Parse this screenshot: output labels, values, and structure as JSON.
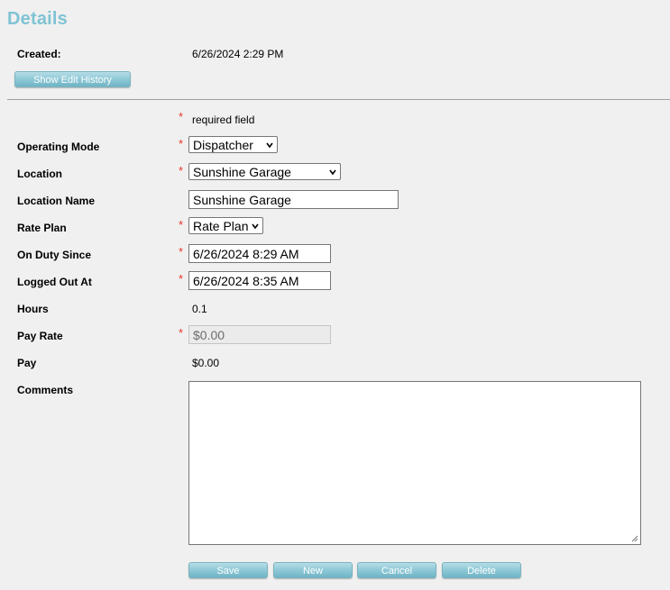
{
  "header": {
    "title": "Details"
  },
  "created": {
    "label": "Created:",
    "value": "6/26/2024 2:29 PM"
  },
  "show_history_button": "Show Edit History",
  "required_note": {
    "marker": "*",
    "text": "required field"
  },
  "fields": {
    "operating_mode": {
      "label": "Operating Mode",
      "value": "Dispatcher"
    },
    "location": {
      "label": "Location",
      "value": "Sunshine Garage"
    },
    "location_name": {
      "label": "Location Name",
      "value": "Sunshine Garage"
    },
    "rate_plan": {
      "label": "Rate Plan",
      "value": "Rate Plan"
    },
    "on_duty_since": {
      "label": "On Duty Since",
      "value": "6/26/2024 8:29 AM"
    },
    "logged_out_at": {
      "label": "Logged Out At",
      "value": "6/26/2024 8:35 AM"
    },
    "hours": {
      "label": "Hours",
      "value": "0.1"
    },
    "pay_rate": {
      "label": "Pay Rate",
      "value": "$0.00"
    },
    "pay": {
      "label": "Pay",
      "value": "$0.00"
    },
    "comments": {
      "label": "Comments",
      "value": ""
    }
  },
  "buttons": {
    "save": "Save",
    "new": "New",
    "cancel": "Cancel",
    "delete": "Delete"
  },
  "colors": {
    "title": "#7fc3d4",
    "required": "#e8352c",
    "button": "#8ec8d6"
  }
}
